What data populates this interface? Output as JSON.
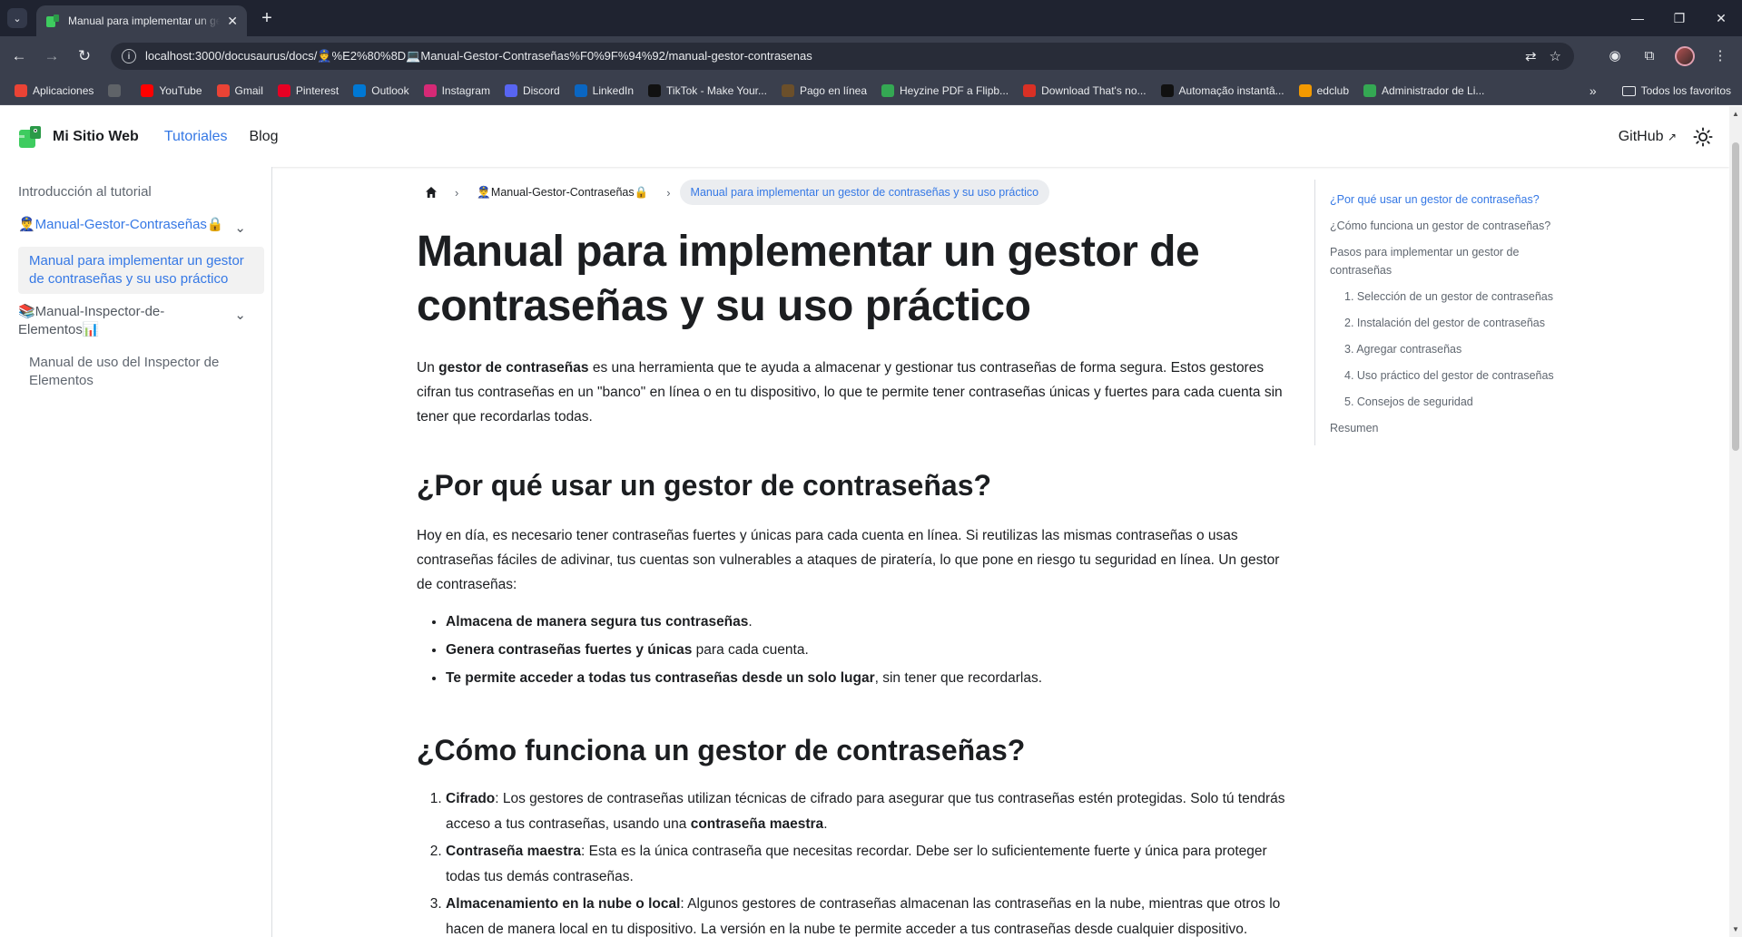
{
  "browser": {
    "tab_title": "Manual para implementar un gestor de contraseñas y su uso práctico",
    "url": "localhost:3000/docusaurus/docs/👮%E2%80%8D💻Manual-Gestor-Contraseñas%F0%9F%94%92/manual-gestor-contrasenas",
    "bookmarks": [
      {
        "label": "Aplicaciones",
        "icon": "apps-grid-icon",
        "color": "#ea4335"
      },
      {
        "label": "",
        "icon": "grid-icon",
        "color": "#5f6368"
      },
      {
        "label": "YouTube",
        "icon": "youtube-icon",
        "color": "#ff0000"
      },
      {
        "label": "Gmail",
        "icon": "gmail-icon",
        "color": "#ea4335"
      },
      {
        "label": "Pinterest",
        "icon": "pinterest-icon",
        "color": "#e60023"
      },
      {
        "label": "Outlook",
        "icon": "outlook-icon",
        "color": "#0078d4"
      },
      {
        "label": "Instagram",
        "icon": "instagram-icon",
        "color": "#d62976"
      },
      {
        "label": "Discord",
        "icon": "discord-icon",
        "color": "#5865f2"
      },
      {
        "label": "LinkedIn",
        "icon": "linkedin-icon",
        "color": "#0a66c2"
      },
      {
        "label": "TikTok - Make Your...",
        "icon": "tiktok-icon",
        "color": "#111111"
      },
      {
        "label": "Pago en línea",
        "icon": "pago-icon",
        "color": "#6b4f2a"
      },
      {
        "label": "Heyzine PDF a Flipb...",
        "icon": "heyzine-icon",
        "color": "#34a853"
      },
      {
        "label": "Download That's no...",
        "icon": "download-icon",
        "color": "#d93025"
      },
      {
        "label": "Automação instantâ...",
        "icon": "automacao-icon",
        "color": "#111111"
      },
      {
        "label": "edclub",
        "icon": "edclub-icon",
        "color": "#f29900"
      },
      {
        "label": "Administrador de Li...",
        "icon": "administrador-icon",
        "color": "#34a853"
      }
    ],
    "all_bookmarks_label": "Todos los favoritos"
  },
  "navbar": {
    "brand": "Mi Sitio Web",
    "links": [
      "Tutoriales",
      "Blog"
    ],
    "github": "GitHub"
  },
  "sidebar": {
    "items": [
      {
        "label": "Introducción al tutorial"
      },
      {
        "label": "👮‍♂️Manual-Gestor-Contraseñas🔒"
      },
      {
        "label": "Manual para implementar un gestor de contraseñas y su uso práctico"
      },
      {
        "label": "📚Manual-Inspector-de-Elementos📊"
      },
      {
        "label": "Manual de uso del Inspector de Elementos"
      }
    ]
  },
  "breadcrumbs": {
    "category": "👮‍♂️Manual-Gestor-Contraseñas🔒",
    "current": "Manual para implementar un gestor de contraseñas y su uso práctico"
  },
  "content": {
    "title": "Manual para implementar un gestor de contraseñas y su uso práctico",
    "intro_pre": "Un ",
    "intro_bold": "gestor de contraseñas",
    "intro_post": " es una herramienta que te ayuda a almacenar y gestionar tus contraseñas de forma segura. Estos gestores cifran tus contraseñas en un \"banco\" en línea o en tu dispositivo, lo que te permite tener contraseñas únicas y fuertes para cada cuenta sin tener que recordarlas todas.",
    "h2_why": "¿Por qué usar un gestor de contraseñas?",
    "why_para": "Hoy en día, es necesario tener contraseñas fuertes y únicas para cada cuenta en línea. Si reutilizas las mismas contraseñas o usas contraseñas fáciles de adivinar, tus cuentas son vulnerables a ataques de piratería, lo que pone en riesgo tu seguridad en línea. Un gestor de contraseñas:",
    "bullets": [
      {
        "bold": "Almacena de manera segura tus contraseñas",
        "rest": "."
      },
      {
        "bold": "Genera contraseñas fuertes y únicas",
        "rest": " para cada cuenta."
      },
      {
        "bold": "Te permite acceder a todas tus contraseñas desde un solo lugar",
        "rest": ", sin tener que recordarlas."
      }
    ],
    "h2_how": "¿Cómo funciona un gestor de contraseñas?",
    "steps": [
      {
        "bold": "Cifrado",
        "rest": ": Los gestores de contraseñas utilizan técnicas de cifrado para asegurar que tus contraseñas estén protegidas. Solo tú tendrás acceso a tus contraseñas, usando una ",
        "bold2": "contraseña maestra",
        "rest2": "."
      },
      {
        "bold": "Contraseña maestra",
        "rest": ": Esta es la única contraseña que necesitas recordar. Debe ser lo suficientemente fuerte y única para proteger todas tus demás contraseñas.",
        "bold2": "",
        "rest2": ""
      },
      {
        "bold": "Almacenamiento en la nube o local",
        "rest": ": Algunos gestores de contraseñas almacenan las contraseñas en la nube, mientras que otros lo hacen de manera local en tu dispositivo. La versión en la nube te permite acceder a tus contraseñas desde cualquier dispositivo.",
        "bold2": "",
        "rest2": ""
      }
    ]
  },
  "toc": [
    {
      "label": "¿Por qué usar un gestor de contraseñas?",
      "active": true,
      "sub": false
    },
    {
      "label": "¿Cómo funciona un gestor de contraseñas?",
      "sub": false
    },
    {
      "label": "Pasos para implementar un gestor de contraseñas",
      "sub": false
    },
    {
      "label": "1. Selección de un gestor de contraseñas",
      "sub": true
    },
    {
      "label": "2. Instalación del gestor de contraseñas",
      "sub": true
    },
    {
      "label": "3. Agregar contraseñas",
      "sub": true
    },
    {
      "label": "4. Uso práctico del gestor de contraseñas",
      "sub": true
    },
    {
      "label": "5. Consejos de seguridad",
      "sub": true
    },
    {
      "label": "Resumen",
      "sub": false
    }
  ]
}
